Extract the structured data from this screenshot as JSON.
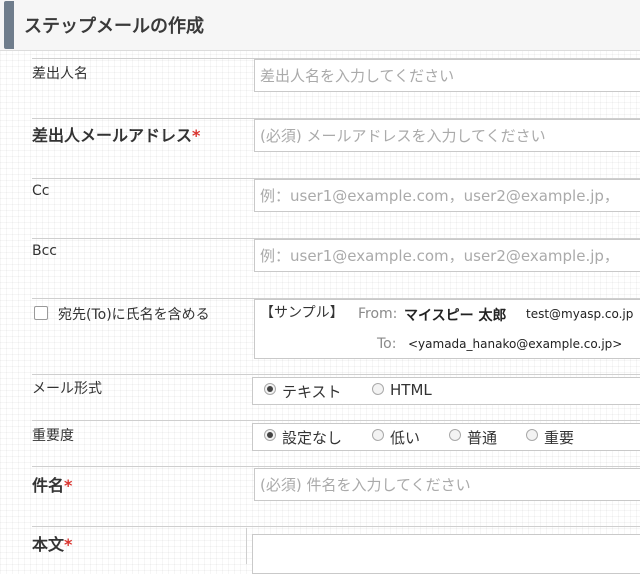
{
  "page": {
    "title": "ステップメールの作成"
  },
  "form": {
    "sender_name": {
      "label": "差出人名",
      "placeholder": "差出人名を入力してください"
    },
    "sender_email": {
      "label": "差出人メールアドレス",
      "required_mark": "*",
      "placeholder": "(必須) メールアドレスを入力してください"
    },
    "cc": {
      "label": "Cc",
      "placeholder": "例：user1@example.com，user2@example.jp，"
    },
    "bcc": {
      "label": "Bcc",
      "placeholder": "例：user1@example.com，user2@example.jp，"
    },
    "include_name": {
      "label": "宛先(To)に氏名を含める",
      "checked": false,
      "sample": {
        "heading": "【サンプル】",
        "from_key": "From:",
        "from_name": "マイスピー 太郎",
        "from_email": "test@myasp.co.jp",
        "to_key": "To:",
        "to_value": "<yamada_hanako@example.co.jp>"
      }
    },
    "mail_format": {
      "label": "メール形式",
      "options": [
        "テキスト",
        "HTML"
      ],
      "selected": "テキスト"
    },
    "priority": {
      "label": "重要度",
      "options": [
        "設定なし",
        "低い",
        "普通",
        "重要"
      ],
      "selected": "設定なし"
    },
    "subject": {
      "label": "件名",
      "required_mark": "*",
      "placeholder": "(必須) 件名を入力してください"
    },
    "body": {
      "label": "本文",
      "required_mark": "*"
    }
  }
}
